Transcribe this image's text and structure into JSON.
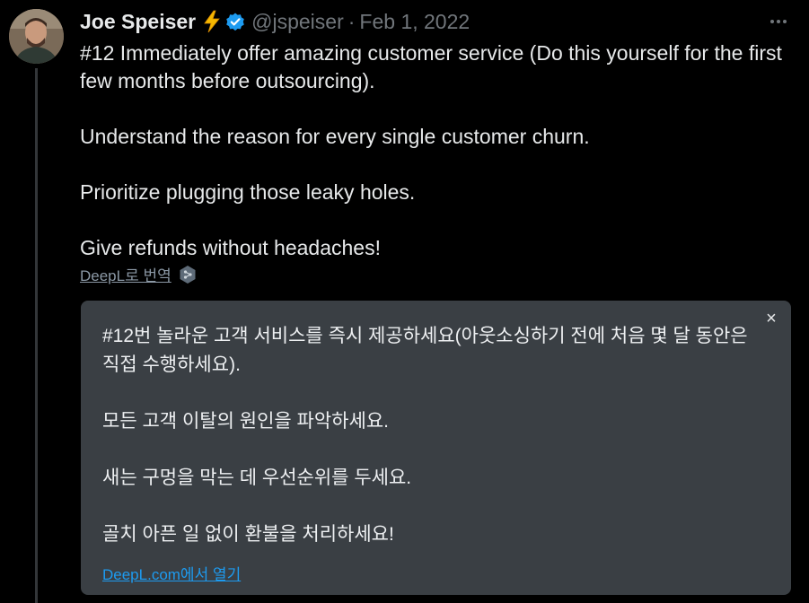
{
  "author": {
    "display_name": "Joe Speiser",
    "handle": "@jspeiser",
    "separator": "·",
    "date": "Feb 1, 2022"
  },
  "icons": {
    "bolt": "lightning-bolt-icon",
    "verified": "verified-badge-icon",
    "more": "more-options-icon",
    "deepl": "deepl-logo-icon",
    "close": "close-icon"
  },
  "colors": {
    "background": "#000000",
    "text": "#e7e9ea",
    "muted": "#71767b",
    "verified": "#1d9bf0",
    "bolt": "#f5b800",
    "translation_bg": "#3a3f44",
    "link": "#1d9bf0"
  },
  "tweet": {
    "paragraphs": [
      "#12 Immediately offer amazing customer service (Do this yourself for the first few months before outsourcing).",
      "Understand the reason for every single customer churn.",
      "Prioritize plugging those leaky holes.",
      "Give refunds without headaches!"
    ]
  },
  "translate": {
    "link_label": "DeepL로 번역",
    "close_label": "×",
    "paragraphs": [
      "#12번 놀라운 고객 서비스를 즉시 제공하세요(아웃소싱하기 전에 처음 몇 달 동안은 직접 수행하세요).",
      "모든 고객 이탈의 원인을 파악하세요.",
      "새는 구멍을 막는 데 우선순위를 두세요.",
      "골치 아픈 일 없이 환불을 처리하세요!"
    ],
    "open_link_label": "DeepL.com에서 열기"
  }
}
